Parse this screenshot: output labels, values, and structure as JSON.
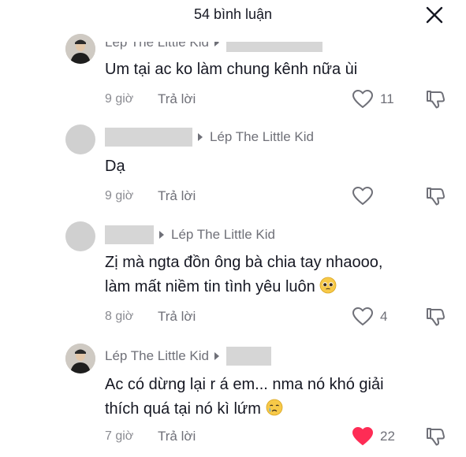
{
  "header": {
    "title": "54 bình luận"
  },
  "comments": [
    {
      "author": "Lép The Little Kid",
      "text": "Um tại ac ko làm chung kênh nữa ùi",
      "time": "9 giờ",
      "reply_label": "Trả lời",
      "likes": "11",
      "liked": false
    },
    {
      "reply_to": "Lép The Little Kid",
      "text": "Dạ",
      "time": "9 giờ",
      "reply_label": "Trả lời",
      "likes": "",
      "liked": false
    },
    {
      "reply_to": "Lép The Little Kid",
      "text_line1": "Zị mà ngta đồn ông bà chia tay nhaooo,",
      "text_line2": "làm mất niềm tin tình yêu luôn",
      "emoji": "pleading-face-emoji",
      "time": "8 giờ",
      "reply_label": "Trả lời",
      "likes": "4",
      "liked": false
    },
    {
      "author": "Lép The Little Kid",
      "text_line1": "Ac có dừng lại r á em... nma nó khó giải",
      "text_line2": "thích quá tại nó kì lứm",
      "emoji": "crying-face-emoji",
      "time": "7 giờ",
      "reply_label": "Trả lời",
      "likes": "22",
      "liked": true
    }
  ],
  "colors": {
    "liked_heart": "#fe2c55",
    "muted_text": "#8a8b91",
    "redaction": "#d6d6d6"
  }
}
